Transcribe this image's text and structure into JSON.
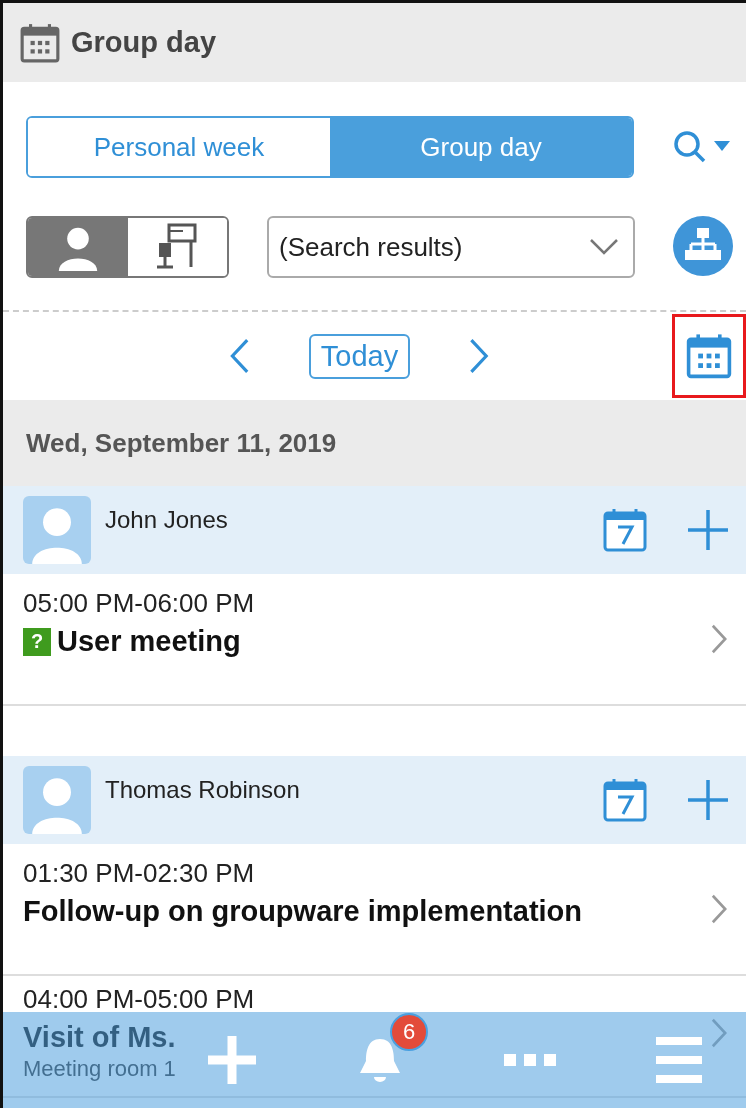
{
  "header": {
    "title": "Group day"
  },
  "view_tabs": [
    {
      "label": "Personal week",
      "selected": false
    },
    {
      "label": "Group day",
      "selected": true
    }
  ],
  "target_toggle": [
    {
      "kind": "user",
      "selected": true
    },
    {
      "kind": "facility",
      "selected": false
    }
  ],
  "group_select": {
    "value": "(Search results)"
  },
  "nav": {
    "today": "Today",
    "calendar_highlighted": true
  },
  "date": "Wed, September 11, 2019",
  "users": [
    {
      "name": "John Jones",
      "events": [
        {
          "time": "05:00 PM-06:00 PM",
          "title": "User meeting",
          "status_mark": "?"
        }
      ]
    },
    {
      "name": "Thomas Robinson",
      "events": [
        {
          "time": "01:30 PM-02:30 PM",
          "title": "Follow-up on groupware implementation"
        },
        {
          "time": "04:00 PM-05:00 PM",
          "title": "Visit of Ms.",
          "place": "Meeting room 1"
        }
      ]
    }
  ],
  "bottom_bar": {
    "notification_count": "6"
  }
}
